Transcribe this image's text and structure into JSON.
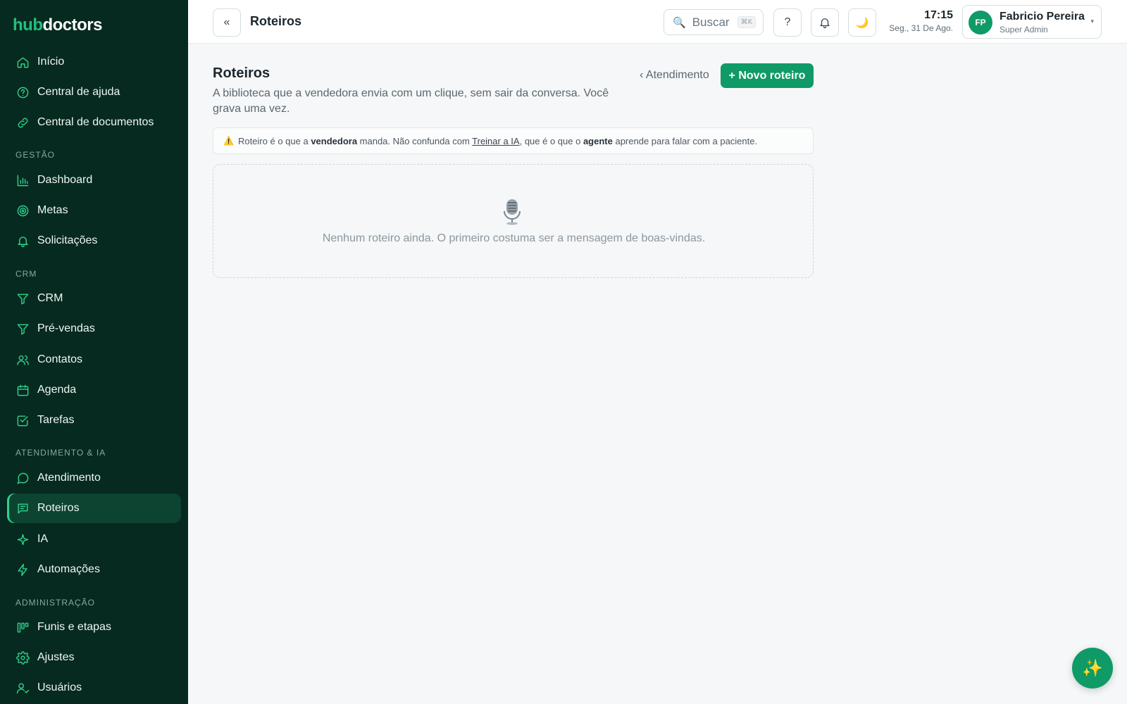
{
  "brand": {
    "part1": "hub",
    "part2": "doctors",
    "accent": "#22c07f"
  },
  "sidebar": {
    "top_items": [
      {
        "label": "Início",
        "icon": "home-icon"
      },
      {
        "label": "Central de ajuda",
        "icon": "help-circle-icon"
      },
      {
        "label": "Central de documentos",
        "icon": "link-icon"
      }
    ],
    "sections": [
      {
        "title": "GESTÃO",
        "items": [
          {
            "label": "Dashboard",
            "icon": "bar-chart-icon"
          },
          {
            "label": "Metas",
            "icon": "target-icon"
          },
          {
            "label": "Solicitações",
            "icon": "bell-icon"
          }
        ]
      },
      {
        "title": "CRM",
        "items": [
          {
            "label": "CRM",
            "icon": "funnel-icon"
          },
          {
            "label": "Pré-vendas",
            "icon": "funnel-icon"
          },
          {
            "label": "Contatos",
            "icon": "users-icon"
          },
          {
            "label": "Agenda",
            "icon": "calendar-icon"
          },
          {
            "label": "Tarefas",
            "icon": "checkbox-icon"
          }
        ]
      },
      {
        "title": "ATENDIMENTO & IA",
        "items": [
          {
            "label": "Atendimento",
            "icon": "chat-bubble-icon"
          },
          {
            "label": "Roteiros",
            "icon": "message-lines-icon",
            "active": true
          },
          {
            "label": "IA",
            "icon": "sparkle-icon"
          },
          {
            "label": "Automações",
            "icon": "bolt-icon"
          }
        ]
      },
      {
        "title": "ADMINISTRAÇÃO",
        "items": [
          {
            "label": "Funis e etapas",
            "icon": "kanban-icon"
          },
          {
            "label": "Ajustes",
            "icon": "gear-icon"
          },
          {
            "label": "Usuários",
            "icon": "user-check-icon"
          }
        ]
      }
    ]
  },
  "topbar": {
    "collapse_label": "«",
    "title": "Roteiros",
    "search": {
      "label": "Buscar",
      "shortcut": "⌘K"
    },
    "help_label": "?",
    "time": "17:15",
    "date": "Seg., 31 De Ago.",
    "user": {
      "initials": "FP",
      "name": "Fabricio Pereira",
      "role": "Super Admin"
    }
  },
  "main": {
    "title": "Roteiros",
    "description": "A biblioteca que a vendedora envia com um clique, sem sair da conversa. Você grava uma vez.",
    "back_label": "‹ Atendimento",
    "new_button": "+ Novo roteiro",
    "notice": {
      "p1": "Roteiro é o que a ",
      "b1": "vendedora",
      "p2": " manda. Não confunda com ",
      "link": "Treinar a IA",
      "p3": ", que é o que o ",
      "b2": "agente",
      "p4": " aprende para falar com a paciente."
    },
    "empty_text": "Nenhum roteiro ainda. O primeiro costuma ser a mensagem de boas-vindas."
  },
  "colors": {
    "sidebar_bg": "#062a1f",
    "primary": "#0f9a67"
  }
}
